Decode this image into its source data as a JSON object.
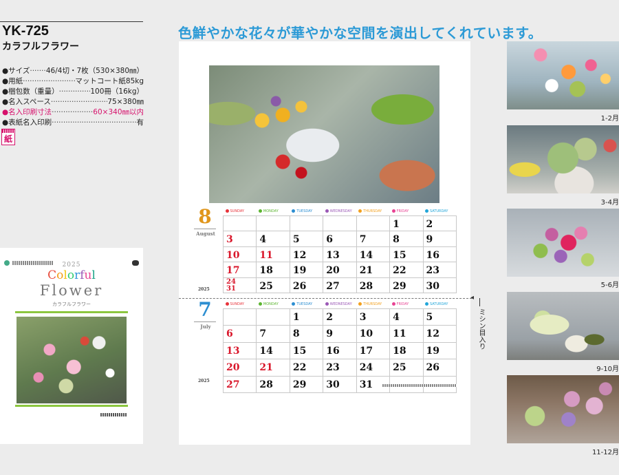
{
  "product": {
    "code": "YK-725",
    "name": "カラフルフラワー"
  },
  "specs": [
    {
      "label": "●サイズ",
      "value": "46/4切・7枚（530×380㎜）",
      "highlight": false
    },
    {
      "label": "●用紙",
      "value": "マットコート紙85kg",
      "highlight": false
    },
    {
      "label": "●梱包数（重量）",
      "value": "100冊（16kg）",
      "highlight": false
    },
    {
      "label": "●名入スペース",
      "value": "75×380㎜",
      "highlight": false
    },
    {
      "label": "●名入印刷寸法",
      "value": "60×340㎜以内",
      "highlight": true
    },
    {
      "label": "●表紙名入印刷",
      "value": "有",
      "highlight": false
    }
  ],
  "material_badge": "紙",
  "cover": {
    "year": "2025",
    "title_line1": "Colorful",
    "title_line2": "Flower",
    "subtitle": "カラフルフラワー",
    "title_colors": [
      "#e74c3c",
      "#f39c12",
      "#f1c40f",
      "#2ecc71",
      "#3498db",
      "#9b59b6",
      "#e84393",
      "#16a085"
    ]
  },
  "headline": "色鮮やかな花々が華やかな空間を演出してくれています。",
  "weekdays": [
    {
      "label": "SUNDAY",
      "color": "#e8333a"
    },
    {
      "label": "MONDAY",
      "color": "#5cb531"
    },
    {
      "label": "TUESDAY",
      "color": "#2c8ed1"
    },
    {
      "label": "WEDNESDAY",
      "color": "#9b59b6"
    },
    {
      "label": "THURSDAY",
      "color": "#f2a01e"
    },
    {
      "label": "FRIDAY",
      "color": "#e84393"
    },
    {
      "label": "SATURDAY",
      "color": "#22a6d9"
    }
  ],
  "calendars": [
    {
      "month_number": "8",
      "month_name": "August",
      "year": "2025",
      "weeks": [
        [
          null,
          null,
          null,
          null,
          null,
          {
            "d": "1"
          },
          {
            "d": "2"
          }
        ],
        [
          {
            "d": "3",
            "red": true
          },
          {
            "d": "4"
          },
          {
            "d": "5"
          },
          {
            "d": "6"
          },
          {
            "d": "7"
          },
          {
            "d": "8"
          },
          {
            "d": "9"
          }
        ],
        [
          {
            "d": "10",
            "red": true
          },
          {
            "d": "11",
            "red": true
          },
          {
            "d": "12"
          },
          {
            "d": "13"
          },
          {
            "d": "14"
          },
          {
            "d": "15"
          },
          {
            "d": "16"
          }
        ],
        [
          {
            "d": "17",
            "red": true
          },
          {
            "d": "18"
          },
          {
            "d": "19"
          },
          {
            "d": "20"
          },
          {
            "d": "21"
          },
          {
            "d": "22"
          },
          {
            "d": "23"
          }
        ],
        [
          {
            "d": "24",
            "d2": "31",
            "red": true
          },
          {
            "d": "25"
          },
          {
            "d": "26"
          },
          {
            "d": "27"
          },
          {
            "d": "28"
          },
          {
            "d": "29"
          },
          {
            "d": "30"
          }
        ]
      ]
    },
    {
      "month_number": "7",
      "month_name": "July",
      "year": "2025",
      "weeks": [
        [
          null,
          null,
          {
            "d": "1"
          },
          {
            "d": "2"
          },
          {
            "d": "3"
          },
          {
            "d": "4"
          },
          {
            "d": "5"
          }
        ],
        [
          {
            "d": "6",
            "red": true
          },
          {
            "d": "7"
          },
          {
            "d": "8"
          },
          {
            "d": "9"
          },
          {
            "d": "10"
          },
          {
            "d": "11"
          },
          {
            "d": "12"
          }
        ],
        [
          {
            "d": "13",
            "red": true
          },
          {
            "d": "14"
          },
          {
            "d": "15"
          },
          {
            "d": "16"
          },
          {
            "d": "17"
          },
          {
            "d": "18"
          },
          {
            "d": "19"
          }
        ],
        [
          {
            "d": "20",
            "red": true
          },
          {
            "d": "21",
            "red": true
          },
          {
            "d": "22"
          },
          {
            "d": "23"
          },
          {
            "d": "24"
          },
          {
            "d": "25"
          },
          {
            "d": "26"
          }
        ],
        [
          {
            "d": "27",
            "red": true
          },
          {
            "d": "28"
          },
          {
            "d": "29"
          },
          {
            "d": "30"
          },
          {
            "d": "31"
          },
          null,
          null
        ]
      ]
    }
  ],
  "perforation_label": "ミシン目入り",
  "thumbnails": [
    {
      "label": "1-2月"
    },
    {
      "label": "3-4月"
    },
    {
      "label": "5-6月"
    },
    {
      "label": "9-10月"
    },
    {
      "label": "11-12月"
    }
  ]
}
